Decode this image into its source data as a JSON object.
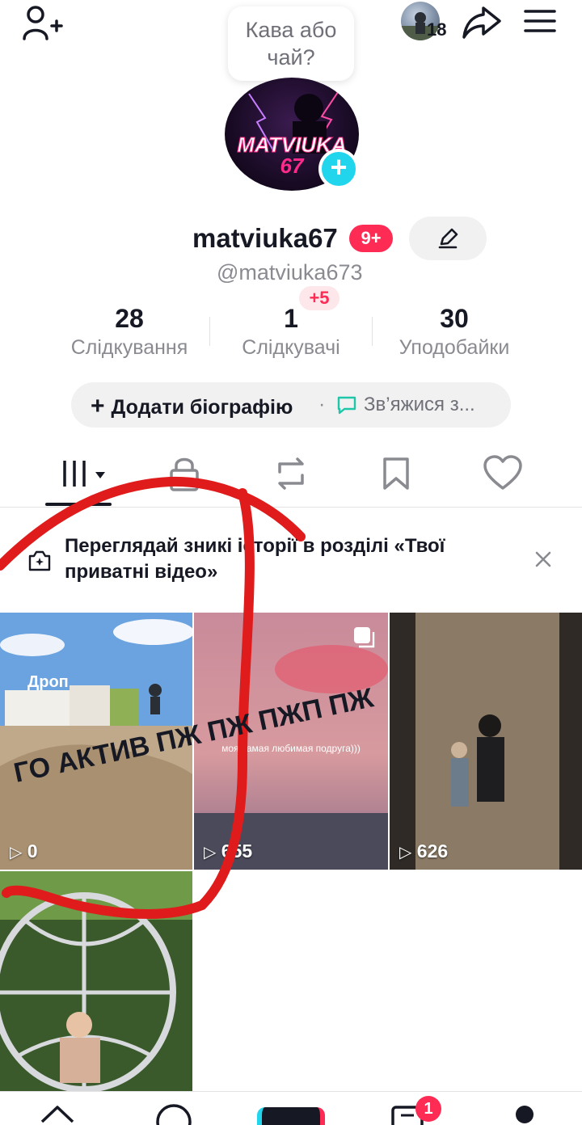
{
  "bubble": {
    "line1": "Кава або",
    "line2": "чай?"
  },
  "header": {
    "friends_count": "18"
  },
  "profile": {
    "avatar_text": "MATVIUKA",
    "avatar_num": "67",
    "username": "matviuka67",
    "badge": "9+",
    "handle": "@matviuka673"
  },
  "stats": {
    "following": {
      "value": "28",
      "label": "Слідкування"
    },
    "followers": {
      "value": "1",
      "label": "Слідкувачі",
      "badge": "+5"
    },
    "likes": {
      "value": "30",
      "label": "Уподобайки"
    }
  },
  "bio": {
    "add": "Додати біографію",
    "dot": "·",
    "contact": "Зв’яжися з..."
  },
  "notice": {
    "text": "Переглядай зникі історії в розділі «Твої приватні відео»"
  },
  "videos": [
    {
      "overlay": "Дроп",
      "views": "0"
    },
    {
      "overlay": "моя самая любимая подруга)))",
      "views": "655"
    },
    {
      "overlay": "",
      "views": "626"
    },
    {
      "overlay": "",
      "views": ""
    }
  ],
  "annotation": {
    "text": "ГО АКТИВ ПЖ ПЖ ПЖП ПЖ",
    "color": "#e01b1b"
  },
  "bottom_nav": {
    "inbox_badge": "1"
  },
  "colors": {
    "accent": "#fe2c55",
    "cyan": "#20d5ec",
    "text": "#161823",
    "secondary": "#8a8b91"
  }
}
